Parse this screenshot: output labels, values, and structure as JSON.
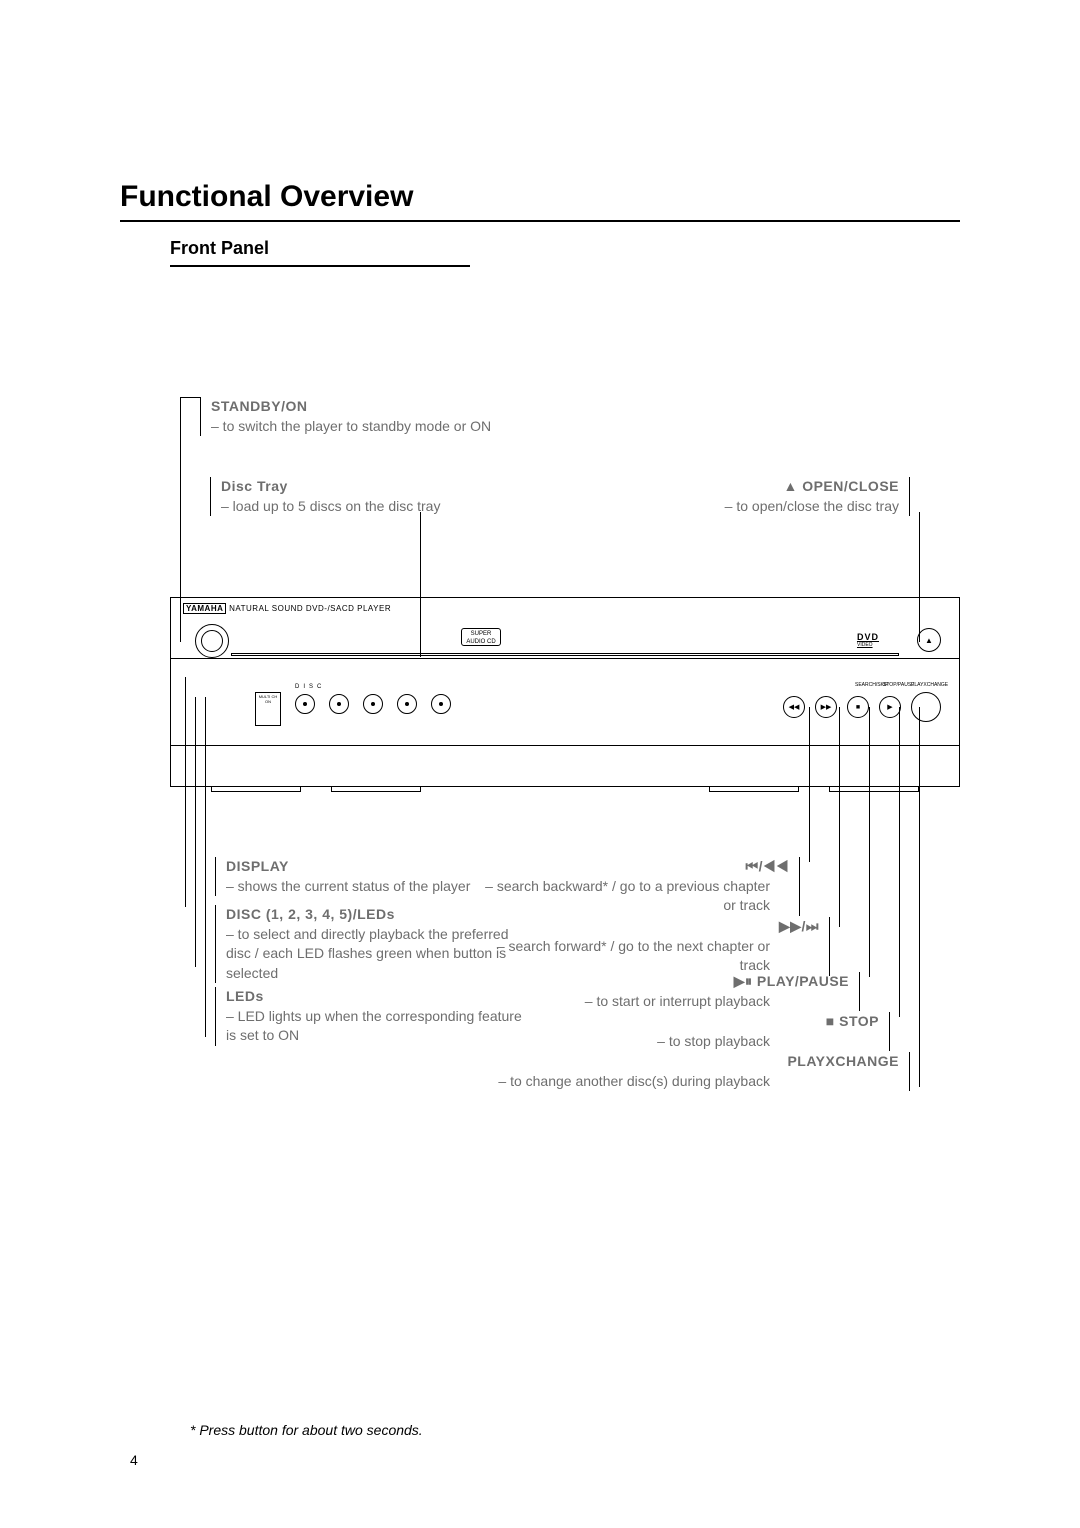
{
  "title": "Functional Overview",
  "section": "Front Panel",
  "brand": "YAMAHA",
  "brand_sub": "NATURAL SOUND DVD-/SACD PLAYER",
  "sacd_line1": "SUPER AUDIO CD",
  "dvd": "DVD",
  "dvd_sub": "VIDEO",
  "eject_glyph": "▲",
  "sound_box": "MULTI\nCH\nON",
  "disc_header": "DISC",
  "t_label_1": "SEARCH/SKIP",
  "t_label_2": "STOP/PAUSE",
  "t_label_3": "PLAYXCHANGE",
  "callouts": {
    "standby": {
      "title": "STANDBY/ON",
      "desc": "– to switch the player to standby mode or ON"
    },
    "disctray": {
      "title": "Disc Tray",
      "desc": "– load up to 5 discs on the disc tray"
    },
    "openclose": {
      "title": "▲ OPEN/CLOSE",
      "desc": "– to open/close the disc tray"
    },
    "display": {
      "title": "DISPLAY",
      "desc": "– shows the current status of the player"
    },
    "discnums": {
      "title": "DISC (1, 2, 3, 4, 5)/LEDs",
      "desc": "– to select and directly playback the preferred disc / each LED flashes green when button is selected"
    },
    "leds": {
      "title": "LEDs",
      "desc": "– LED lights up when the corresponding feature is set to ON"
    },
    "prev": {
      "title": "⏮/◀◀",
      "desc": "– search backward* / go to a previous chapter or track"
    },
    "next": {
      "title": "▶▶/⏭",
      "desc": "– search forward* / go to the next chapter or track"
    },
    "playpause": {
      "title": "▶⏸ PLAY/PAUSE",
      "desc": "– to start or interrupt playback"
    },
    "stop": {
      "title": "■ STOP",
      "desc": "– to stop playback"
    },
    "playxchange": {
      "title": "PLAYXCHANGE",
      "desc": "– to change another disc(s) during playback"
    }
  },
  "footnote": "* Press button for about two seconds.",
  "page_number": "4"
}
